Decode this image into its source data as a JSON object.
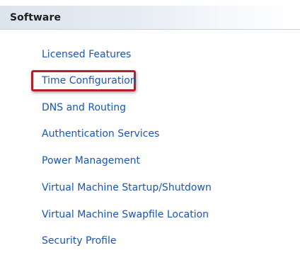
{
  "section": {
    "title": "Software"
  },
  "items": [
    {
      "label": "Licensed Features"
    },
    {
      "label": "Time Configuration"
    },
    {
      "label": "DNS and Routing"
    },
    {
      "label": "Authentication Services"
    },
    {
      "label": "Power Management"
    },
    {
      "label": "Virtual Machine Startup/Shutdown"
    },
    {
      "label": "Virtual Machine Swapfile Location"
    },
    {
      "label": "Security Profile"
    }
  ],
  "highlighted_item": "Time Configuration",
  "colors": {
    "link": "#1a55b8",
    "highlight_border": "#b3202c",
    "header_bg": "#dce4ee"
  }
}
